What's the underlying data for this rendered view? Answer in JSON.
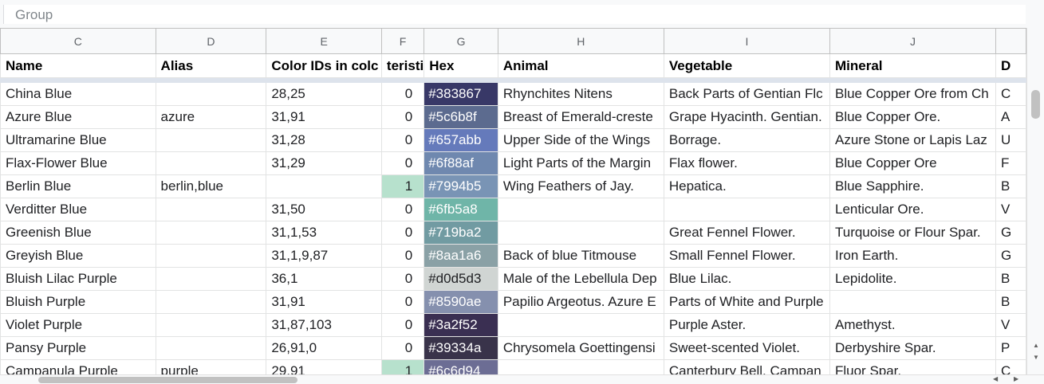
{
  "toolbar": {
    "group_label": "Group"
  },
  "columns": [
    "C",
    "D",
    "E",
    "F",
    "G",
    "H",
    "I",
    "J",
    ""
  ],
  "header": [
    "Name",
    "Alias",
    "Color IDs in colc",
    "teristi",
    "Hex",
    "Animal",
    "Vegetable",
    "Mineral",
    "D"
  ],
  "rows": [
    [
      "China Blue",
      "",
      "28,25",
      "0",
      "#383867",
      "Rhynchites Nitens",
      "Back Parts of Gentian Flc",
      "Blue Copper Ore from Ch",
      "C"
    ],
    [
      "Azure Blue",
      "azure",
      "31,91",
      "0",
      "#5c6b8f",
      "Breast of Emerald-creste",
      "Grape Hyacinth. Gentian.",
      "Blue Copper Ore.",
      "A"
    ],
    [
      "Ultramarine Blue",
      "",
      "31,28",
      "0",
      "#657abb",
      "Upper Side of the Wings",
      "Borrage.",
      "Azure Stone or Lapis Laz",
      "U"
    ],
    [
      "Flax-Flower Blue",
      "",
      "31,29",
      "0",
      "#6f88af",
      "Light Parts of the Margin",
      "Flax flower.",
      "Blue Copper Ore",
      "F"
    ],
    [
      "Berlin Blue",
      "berlin,blue",
      "",
      "1",
      "#7994b5",
      "Wing Feathers of Jay.",
      "Hepatica.",
      "Blue Sapphire.",
      "B"
    ],
    [
      "Verditter Blue",
      "",
      "31,50",
      "0",
      "#6fb5a8",
      "",
      "",
      "Lenticular Ore.",
      "V"
    ],
    [
      "Greenish Blue",
      "",
      "31,1,53",
      "0",
      "#719ba2",
      "",
      "Great Fennel Flower.",
      "Turquoise or Flour Spar.",
      "G"
    ],
    [
      "Greyish Blue",
      "",
      "31,1,9,87",
      "0",
      "#8aa1a6",
      "Back of blue Titmouse",
      "Small Fennel Flower.",
      "Iron Earth.",
      "G"
    ],
    [
      "Bluish Lilac Purple",
      "",
      "36,1",
      "0",
      "#d0d5d3",
      "Male of the Lebellula Dep",
      "Blue Lilac.",
      "Lepidolite.",
      "B"
    ],
    [
      "Bluish Purple",
      "",
      "31,91",
      "0",
      "#8590ae",
      "Papilio Argeotus. Azure E",
      "Parts of White and Purple",
      "",
      "B"
    ],
    [
      "Violet Purple",
      "",
      "31,87,103",
      "0",
      "#3a2f52",
      "",
      "Purple Aster.",
      "Amethyst.",
      "V"
    ],
    [
      "Pansy Purple",
      "",
      "26,91,0",
      "0",
      "#39334a",
      "Chrysomela Goettingensi",
      "Sweet-scented Violet.",
      "Derbyshire Spar.",
      "P"
    ],
    [
      "Campanula Purple",
      "purple",
      "29,91",
      "1",
      "#6c6d94",
      "",
      "Canterbury Bell. Campan",
      "Fluor Spar.",
      "C"
    ]
  ],
  "colors": {
    "flag_highlight": "#b7e1cd",
    "hex_text": "#ffffff",
    "hex_text_light": "#202124"
  }
}
